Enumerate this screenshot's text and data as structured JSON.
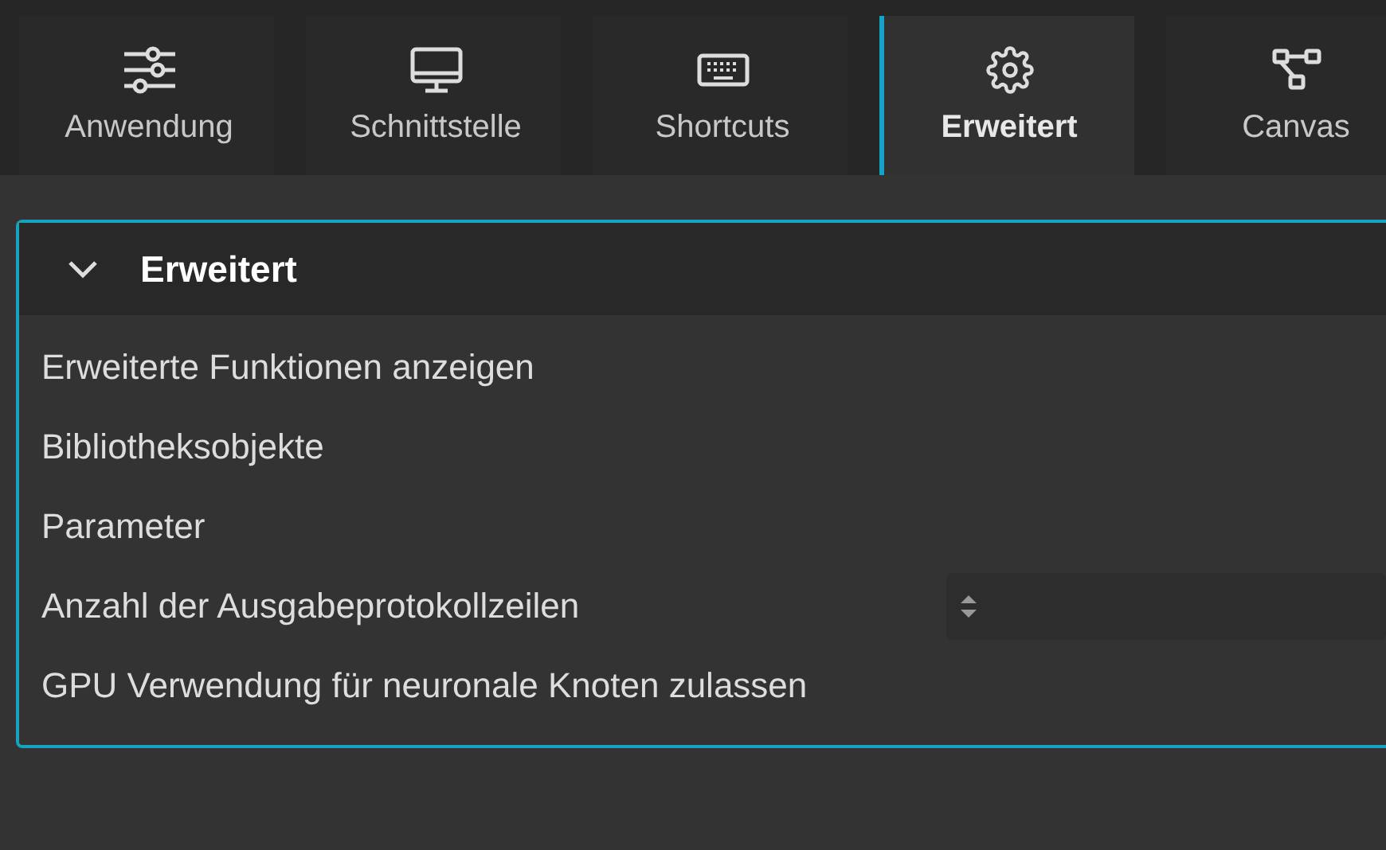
{
  "tabs": [
    {
      "label": "Anwendung",
      "kind": "sliders",
      "selected": false
    },
    {
      "label": "Schnittstelle",
      "kind": "monitor",
      "selected": false
    },
    {
      "label": "Shortcuts",
      "kind": "keyboard",
      "selected": false
    },
    {
      "label": "Erweitert",
      "kind": "gear",
      "selected": true
    },
    {
      "label": "Canvas",
      "kind": "nodes",
      "selected": false
    }
  ],
  "section": {
    "title": "Erweitert",
    "expanded": true,
    "rows": [
      {
        "label": "Erweiterte Funktionen anzeigen",
        "kind": "text"
      },
      {
        "label": "Bibliotheksobjekte",
        "kind": "text"
      },
      {
        "label": "Parameter",
        "kind": "text"
      },
      {
        "label": "Anzahl der Ausgabeprotokollzeilen",
        "kind": "number"
      },
      {
        "label": "GPU Verwendung für neuronale Knoten zulassen",
        "kind": "text"
      }
    ]
  }
}
